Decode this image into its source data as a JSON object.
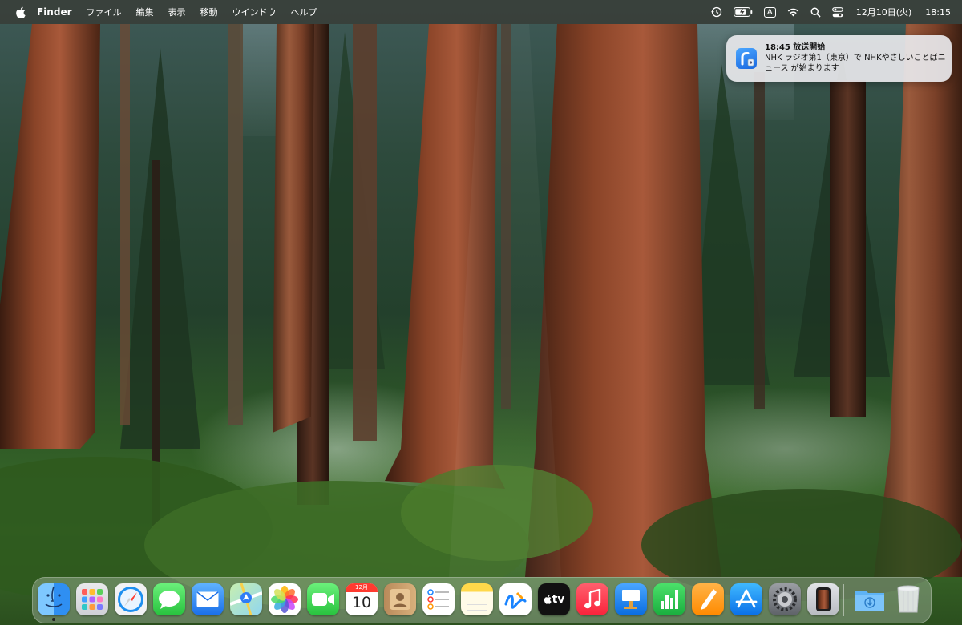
{
  "menubar": {
    "apple_icon": "apple-logo-icon",
    "app_name": "Finder",
    "menus": [
      "ファイル",
      "編集",
      "表示",
      "移動",
      "ウインドウ",
      "ヘルプ"
    ],
    "status_icons": [
      "time-machine-icon",
      "battery-icon",
      "input-source-icon",
      "wifi-icon",
      "spotlight-icon",
      "control-center-icon"
    ],
    "input_source": "A",
    "date": "12月10日(火)",
    "time": "18:15"
  },
  "notification": {
    "icon": "radiko-app-icon",
    "title": "18:45 放送開始",
    "body": "NHK ラジオ第1（東京）で NHKやさしいことばニュース が始まります"
  },
  "dock": {
    "items": [
      {
        "name": "Finder",
        "icon": "finder-icon",
        "running": true
      },
      {
        "name": "Launchpad",
        "icon": "launchpad-icon"
      },
      {
        "name": "Safari",
        "icon": "safari-icon"
      },
      {
        "name": "Messages",
        "icon": "messages-icon"
      },
      {
        "name": "Mail",
        "icon": "mail-icon"
      },
      {
        "name": "Maps",
        "icon": "maps-icon"
      },
      {
        "name": "Photos",
        "icon": "photos-icon"
      },
      {
        "name": "FaceTime",
        "icon": "facetime-icon"
      },
      {
        "name": "Calendar",
        "icon": "calendar-icon",
        "month": "12月",
        "day": "10"
      },
      {
        "name": "Contacts",
        "icon": "contacts-icon"
      },
      {
        "name": "Reminders",
        "icon": "reminders-icon"
      },
      {
        "name": "Notes",
        "icon": "notes-icon"
      },
      {
        "name": "Freeform",
        "icon": "freeform-icon"
      },
      {
        "name": "TV",
        "icon": "apple-tv-icon",
        "label": "tv"
      },
      {
        "name": "Music",
        "icon": "music-icon"
      },
      {
        "name": "Keynote",
        "icon": "keynote-icon"
      },
      {
        "name": "Numbers",
        "icon": "numbers-icon"
      },
      {
        "name": "Pages",
        "icon": "pages-icon"
      },
      {
        "name": "App Store",
        "icon": "app-store-icon"
      },
      {
        "name": "System Settings",
        "icon": "system-settings-icon"
      },
      {
        "name": "iPhone Mirroring",
        "icon": "iphone-mirroring-icon"
      },
      {
        "name": "Downloads",
        "icon": "downloads-folder-icon"
      },
      {
        "name": "Trash",
        "icon": "trash-icon"
      }
    ]
  }
}
